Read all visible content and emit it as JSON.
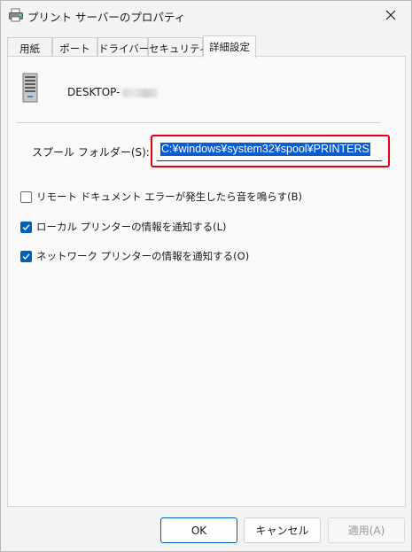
{
  "window": {
    "title": "プリント サーバーのプロパティ"
  },
  "tabs": [
    {
      "label": "用紙",
      "active": false
    },
    {
      "label": "ポート",
      "active": false
    },
    {
      "label": "ドライバー",
      "active": false
    },
    {
      "label": "セキュリティ",
      "active": false
    },
    {
      "label": "詳細設定",
      "active": true
    }
  ],
  "advanced": {
    "server_name": "DESKTOP-",
    "spool_folder_label": "スプール フォルダー(S):",
    "spool_folder_value": "C:¥windows¥system32¥spool¥PRINTERS"
  },
  "checkboxes": [
    {
      "label": "リモート ドキュメント エラーが発生したら音を鳴らす(B)",
      "checked": false
    },
    {
      "label": "ローカル プリンターの情報を通知する(L)",
      "checked": true
    },
    {
      "label": "ネットワーク プリンターの情報を通知する(O)",
      "checked": true
    }
  ],
  "buttons": {
    "ok": "OK",
    "cancel": "キャンセル",
    "apply": "適用(A)"
  },
  "colors": {
    "accent": "#005fb8",
    "highlight": "#0a5ccf",
    "callout": "#e60012"
  }
}
